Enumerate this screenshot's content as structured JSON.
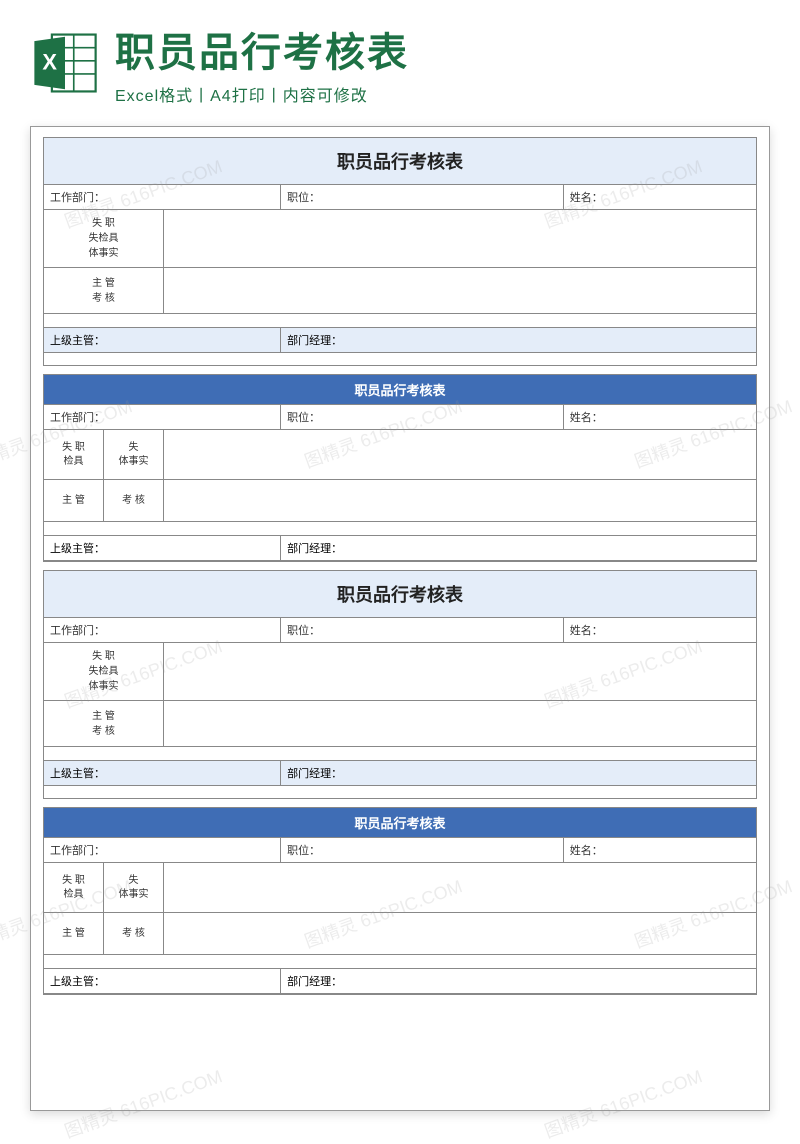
{
  "header": {
    "title": "职员品行考核表",
    "subtitle": "Excel格式丨A4打印丨内容可修改"
  },
  "form": {
    "title_main": "职员品行考核表",
    "title_sub": "职员品行考核表",
    "dept_label": "工作部门：",
    "position_label": "职位：",
    "name_label": "姓名：",
    "fault_label_1": "失 职",
    "fault_label_2": "失检具",
    "fault_label_3": "体事实",
    "fault_split_a1": "失 职",
    "fault_split_a2": "失",
    "fault_split_b1": "检具",
    "fault_split_b2": "体事实",
    "mgr_label_1": "主 管",
    "mgr_label_2": "考 核",
    "mgr_split_a": "主 管",
    "mgr_split_b": "考 核",
    "supervisor_label": "上级主管：",
    "dept_mgr_label": "部门经理："
  },
  "watermark": "图精灵  616PIC.COM"
}
